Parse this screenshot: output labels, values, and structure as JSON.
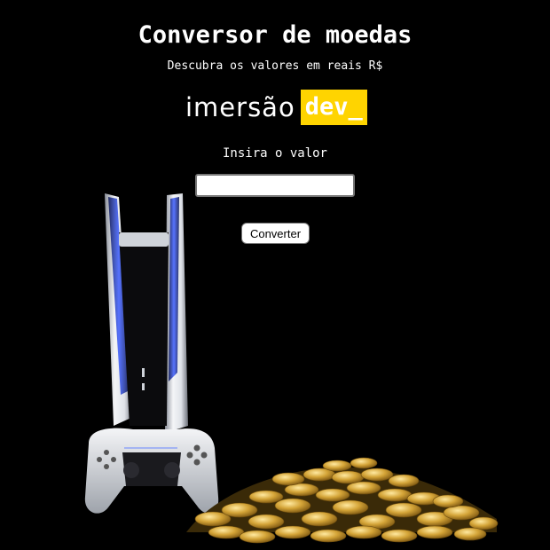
{
  "header": {
    "title": "Conversor de moedas",
    "subtitle": "Descubra os valores em reais R$"
  },
  "logo": {
    "part1": "imersão",
    "part2": "dev_",
    "accent_color": "#ffd400"
  },
  "form": {
    "label": "Insira o valor",
    "input_value": "",
    "input_placeholder": "",
    "button_label": "Converter"
  },
  "background": {
    "color": "#000000",
    "image": "game console with controller and pile of gold coins"
  }
}
